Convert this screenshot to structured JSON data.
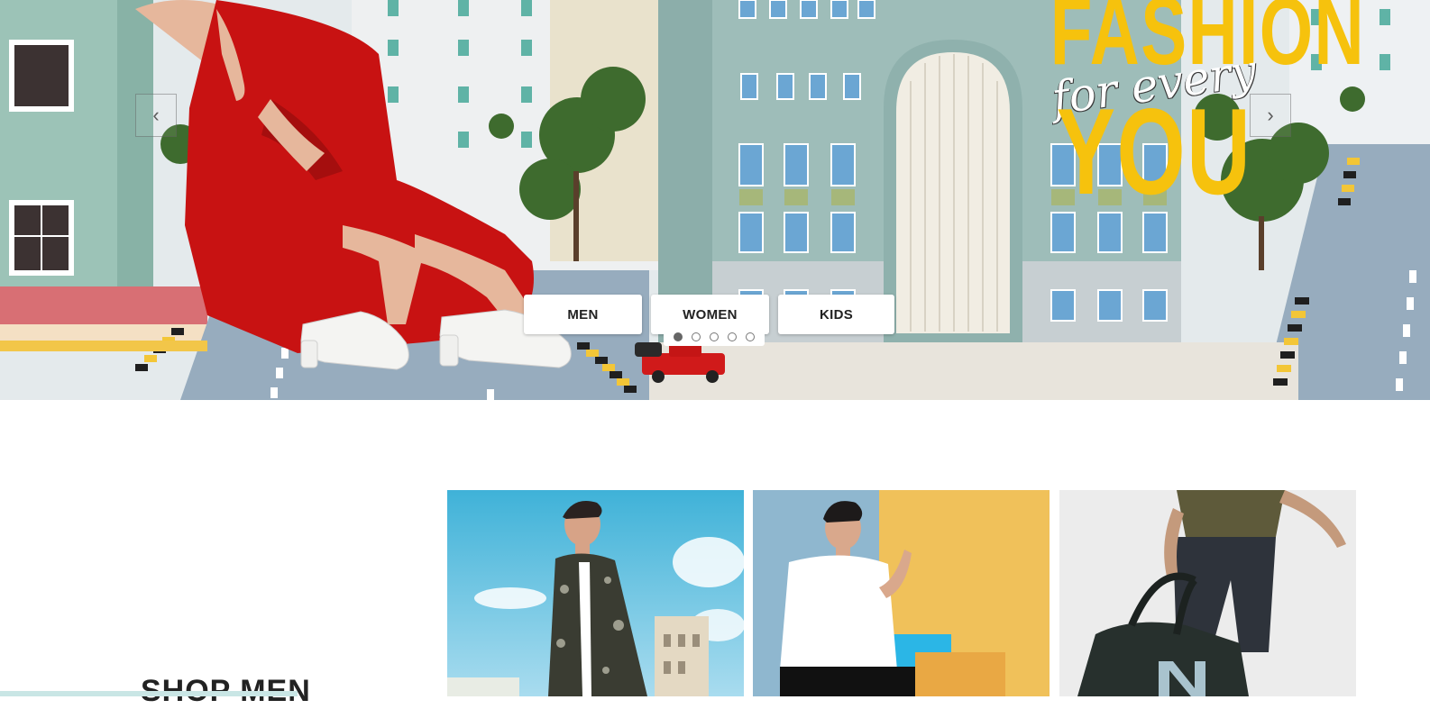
{
  "hero": {
    "headline_top": "FASHION",
    "headline_script": "for every",
    "headline_bottom": "YOU",
    "prev_arrow": "‹",
    "next_arrow": "›",
    "categories": [
      "MEN",
      "WOMEN",
      "KIDS"
    ],
    "slides": {
      "count": 5,
      "active_index": 0
    },
    "colors": {
      "headline": "#f6c20d",
      "dress": "#c81212"
    }
  },
  "shop_men": {
    "title": "SHOP MEN"
  }
}
